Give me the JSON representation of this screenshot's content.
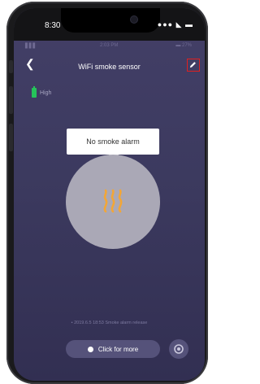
{
  "device": {
    "time": "8:30",
    "status_icons": "●●● ◣ ▬"
  },
  "inner_status": {
    "signal": "▋▋▋",
    "wifi": "▾",
    "time": "2:03 PM",
    "battery": "▬ 27%"
  },
  "header": {
    "back_icon": "chevron-left-icon",
    "title": "WiFi smoke sensor",
    "edit_icon": "pencil-icon"
  },
  "battery_indicator": {
    "label": "High",
    "color": "#25c45a"
  },
  "status_bubble": {
    "text": "No smoke alarm"
  },
  "sensor": {
    "icon": "smoke-icon",
    "icon_color": "#f2a637",
    "circle_color": "#aaa8b6"
  },
  "log": {
    "entry": "• 2019.6.5 18:53 Smoke alarm release"
  },
  "footer": {
    "more_label": "Click for more",
    "settings_icon": "gear-icon"
  },
  "colors": {
    "background": "#3c3a5f",
    "highlight_border": "#e02020"
  }
}
